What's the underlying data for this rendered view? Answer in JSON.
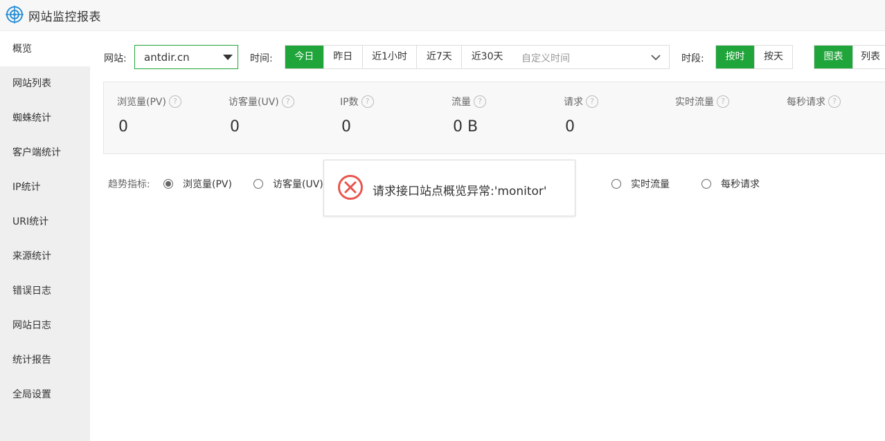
{
  "app": {
    "title": "网站监控报表",
    "icon": "target-icon"
  },
  "sidebar": {
    "items": [
      {
        "label": "概览",
        "active": true
      },
      {
        "label": "网站列表"
      },
      {
        "label": "蜘蛛统计"
      },
      {
        "label": "客户端统计"
      },
      {
        "label": "IP统计"
      },
      {
        "label": "URI统计"
      },
      {
        "label": "来源统计"
      },
      {
        "label": "错误日志"
      },
      {
        "label": "网站日志"
      },
      {
        "label": "统计报告"
      },
      {
        "label": "全局设置"
      }
    ]
  },
  "toolbar": {
    "site_label": "网站:",
    "site_value": "antdir.cn",
    "time_label": "时间:",
    "time_options": [
      "今日",
      "昨日",
      "近1小时",
      "近7天",
      "近30天"
    ],
    "time_selected": "今日",
    "custom_time_placeholder": "自定义时间",
    "period_label": "时段:",
    "period_options": [
      "按时",
      "按天"
    ],
    "period_selected": "按时",
    "view_options": [
      "图表",
      "列表"
    ],
    "view_selected": "图表"
  },
  "stats": [
    {
      "name": "浏览量(PV)",
      "value": "0"
    },
    {
      "name": "访客量(UV)",
      "value": "0"
    },
    {
      "name": "IP数",
      "value": "0"
    },
    {
      "name": "流量",
      "value": "0 B"
    },
    {
      "name": "请求",
      "value": "0"
    },
    {
      "name": "实时流量",
      "value": ""
    },
    {
      "name": "每秒请求",
      "value": ""
    }
  ],
  "help_glyph": "?",
  "trend": {
    "label": "趋势指标:",
    "options": [
      "浏览量(PV)",
      "访客量(UV)",
      "实时流量",
      "每秒请求"
    ],
    "selected": "浏览量(PV)"
  },
  "toast": {
    "message": "请求接口站点概览异常:'monitor'",
    "icon": "error-circle-icon"
  },
  "colors": {
    "accent": "#20a53a",
    "error": "#e8554e"
  }
}
